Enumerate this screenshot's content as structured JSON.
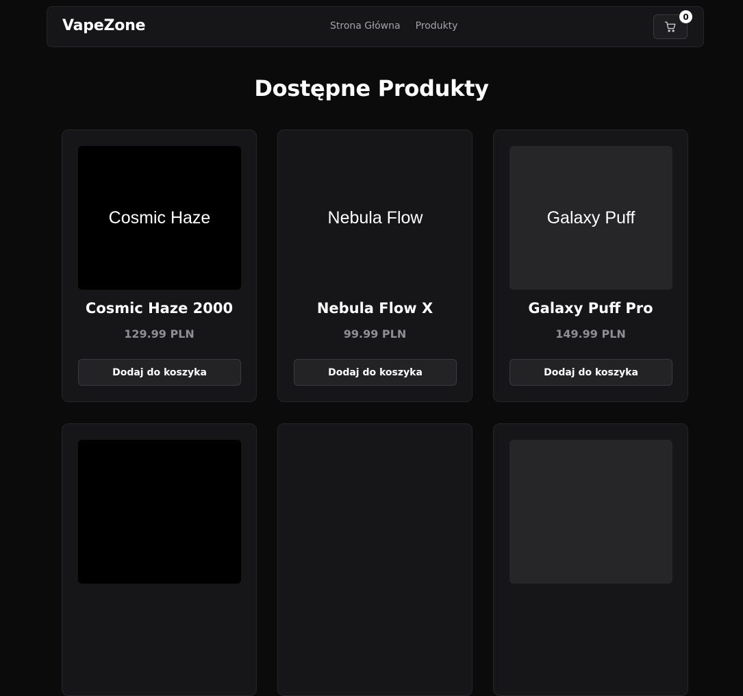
{
  "header": {
    "brand": "VapeZone",
    "nav": [
      {
        "label": "Strona Główna"
      },
      {
        "label": "Produkty"
      }
    ],
    "cart": {
      "icon": "cart-icon",
      "count": "0"
    }
  },
  "main": {
    "title": "Dostępne Produkty",
    "add_to_cart_label": "Dodaj do koszyka",
    "products": [
      {
        "image_text": "Cosmic Haze",
        "name": "Cosmic Haze 2000",
        "price": "129.99 PLN",
        "image_bg": "#000000"
      },
      {
        "image_text": "Nebula Flow",
        "name": "Nebula Flow X",
        "price": "99.99 PLN",
        "image_bg": "#161618"
      },
      {
        "image_text": "Galaxy Puff",
        "name": "Galaxy Puff Pro",
        "price": "149.99 PLN",
        "image_bg": "#262628"
      },
      {
        "image_bg": "#000000"
      },
      {
        "image_bg": "#161618"
      },
      {
        "image_bg": "#262628"
      }
    ]
  },
  "colors": {
    "background": "#0b0b0c",
    "surface": "#161618",
    "border": "#26262a",
    "text": "#ffffff",
    "muted": "#8e8e93",
    "nav_text": "#a3a3a8"
  }
}
